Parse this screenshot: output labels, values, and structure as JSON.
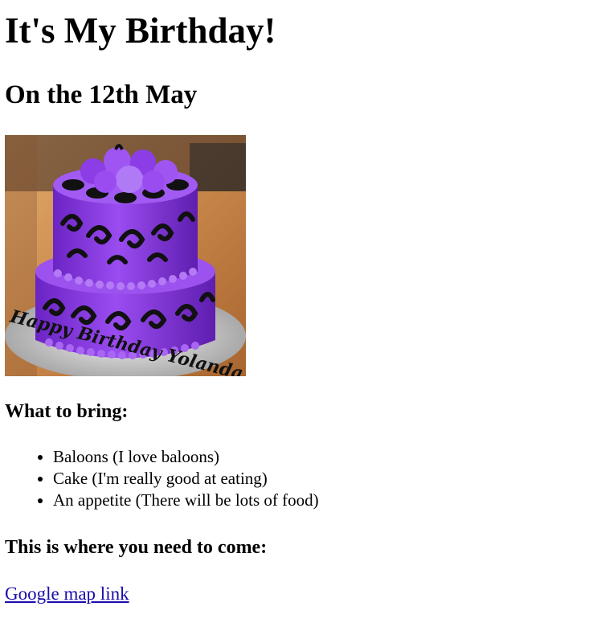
{
  "heading": "It's My Birthday!",
  "subheading": "On the 12th May",
  "image": {
    "alt": "cake",
    "icing_text": "Happy Birthday Yolanda",
    "colors": {
      "icing": "#8a3ce0",
      "piping": "#121212",
      "board": "#c8c8c8",
      "table": "#d8995a"
    }
  },
  "bring": {
    "title": "What to bring:",
    "items": [
      "Baloons (I love baloons)",
      "Cake (I'm really good at eating)",
      "An appetite (There will be lots of food)"
    ]
  },
  "location": {
    "title": "This is where you need to come:",
    "link_label": "Google map link"
  }
}
